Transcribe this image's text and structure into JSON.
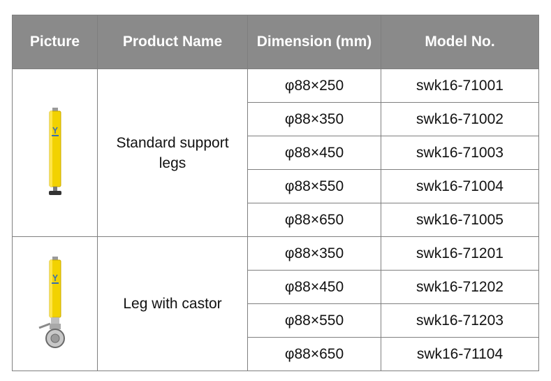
{
  "headers": {
    "picture": "Picture",
    "product_name": "Product Name",
    "dimension": "Dimension (mm)",
    "model_no": "Model No."
  },
  "groups": [
    {
      "product_name": "Standard support legs",
      "image_icon": "yellow-support-leg",
      "rows": [
        {
          "dimension": "φ88×250",
          "model": "swk16-71001"
        },
        {
          "dimension": "φ88×350",
          "model": "swk16-71002"
        },
        {
          "dimension": "φ88×450",
          "model": "swk16-71003"
        },
        {
          "dimension": "φ88×550",
          "model": "swk16-71004"
        },
        {
          "dimension": "φ88×650",
          "model": "swk16-71005"
        }
      ]
    },
    {
      "product_name": "Leg with castor",
      "image_icon": "yellow-leg-with-castor",
      "rows": [
        {
          "dimension": "φ88×350",
          "model": "swk16-71201"
        },
        {
          "dimension": "φ88×450",
          "model": "swk16-71202"
        },
        {
          "dimension": "φ88×550",
          "model": "swk16-71203"
        },
        {
          "dimension": "φ88×650",
          "model": "swk16-71104"
        }
      ]
    }
  ],
  "colors": {
    "header_bg": "#8a8a8a",
    "header_text": "#ffffff",
    "border": "#7f7f7f",
    "leg_yellow": "#f2d200"
  }
}
